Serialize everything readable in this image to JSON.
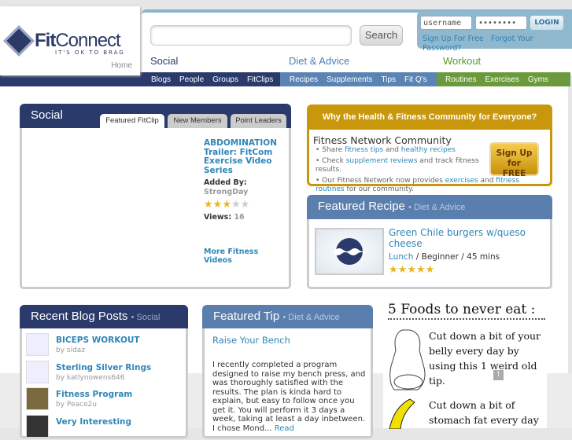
{
  "logo": {
    "brand_a": "Fit",
    "brand_b": "Connect",
    "tagline": "IT'S OK TO BRAG",
    "home": "Home"
  },
  "search": {
    "value": "",
    "button": "Search"
  },
  "login": {
    "username": "username",
    "password": "••••••••",
    "button": "LOGIN",
    "signup": "Sign Up For Free",
    "forgot": "Forgot Your Password?"
  },
  "nav": {
    "social": {
      "label": "Social",
      "items": [
        "Blogs",
        "People",
        "Groups",
        "FitClips"
      ],
      "color": "#2a3a6b"
    },
    "diet": {
      "label": "Diet & Advice",
      "items": [
        "Recipes",
        "Supplements",
        "Tips",
        "Fit Q's"
      ],
      "color": "#5a84b3"
    },
    "workout": {
      "label": "Workout",
      "items": [
        "Routines",
        "Exercises",
        "Gyms"
      ],
      "color": "#6b9a3c"
    }
  },
  "social_panel": {
    "title": "Social",
    "tabs": [
      "Featured FitClip",
      "New Members",
      "Point Leaders"
    ],
    "active_tab": 0,
    "clip_title": "ABDOMINATION Trailer: FitCom Exercise Video Series",
    "added_by_label": "Added By:",
    "added_by": "StrongDay",
    "rating": 3,
    "views_label": "Views:",
    "views": "16",
    "more": "More Fitness Videos"
  },
  "why": {
    "title": "Why the Health & Fitness Community for Everyone?",
    "heading": "Fitness Network Community",
    "b1_pre": "Share ",
    "b1_l1": "fitness tips",
    "b1_mid": " and ",
    "b1_l2": "healthy recipes",
    "b2_pre": "Check ",
    "b2_l1": "supplement reviews",
    "b2_post": " and track fitness results.",
    "b3_pre": "Our Fitness Network now provides ",
    "b3_l1": "exercises",
    "b3_mid": " and ",
    "b3_l2": "fitness routines",
    "b3_post": " for our community.",
    "signup": "Sign Up for FREE"
  },
  "recipe": {
    "title": "Featured Recipe",
    "section": "• Diet & Advice",
    "name": "Green Chile burgers w/queso cheese",
    "meal": "Lunch",
    "rest": " / Beginner / 45 mins",
    "rating": 5
  },
  "blog": {
    "title": "Recent Blog Posts",
    "section": "• Social",
    "posts": [
      {
        "title": "BICEPS WORKOUT",
        "by": "by sidaz"
      },
      {
        "title": "Sterling Silver Rings",
        "by": "by katlynowens646"
      },
      {
        "title": "Fitness Program",
        "by": "by Peace2u"
      },
      {
        "title": "Very Interesting",
        "by": ""
      }
    ]
  },
  "tip": {
    "title": "Featured Tip",
    "section": "• Diet & Advice",
    "name": "Raise Your Bench",
    "body": "I recently completed a program designed to raise my bench press, and was thoroughly satisfied with the results.  The plan is kinda hard to explain, but easy to follow once you get it.  You will perform it 3 days a week, taking at least a day inbetween. I chose Mond...",
    "read": "Read"
  },
  "ad": {
    "title": "5 Foods to never eat :",
    "t1": "Cut down a bit of your belly every day by using  this 1 weird old tip.",
    "t2": "Cut down a bit of stomach fat every day"
  }
}
